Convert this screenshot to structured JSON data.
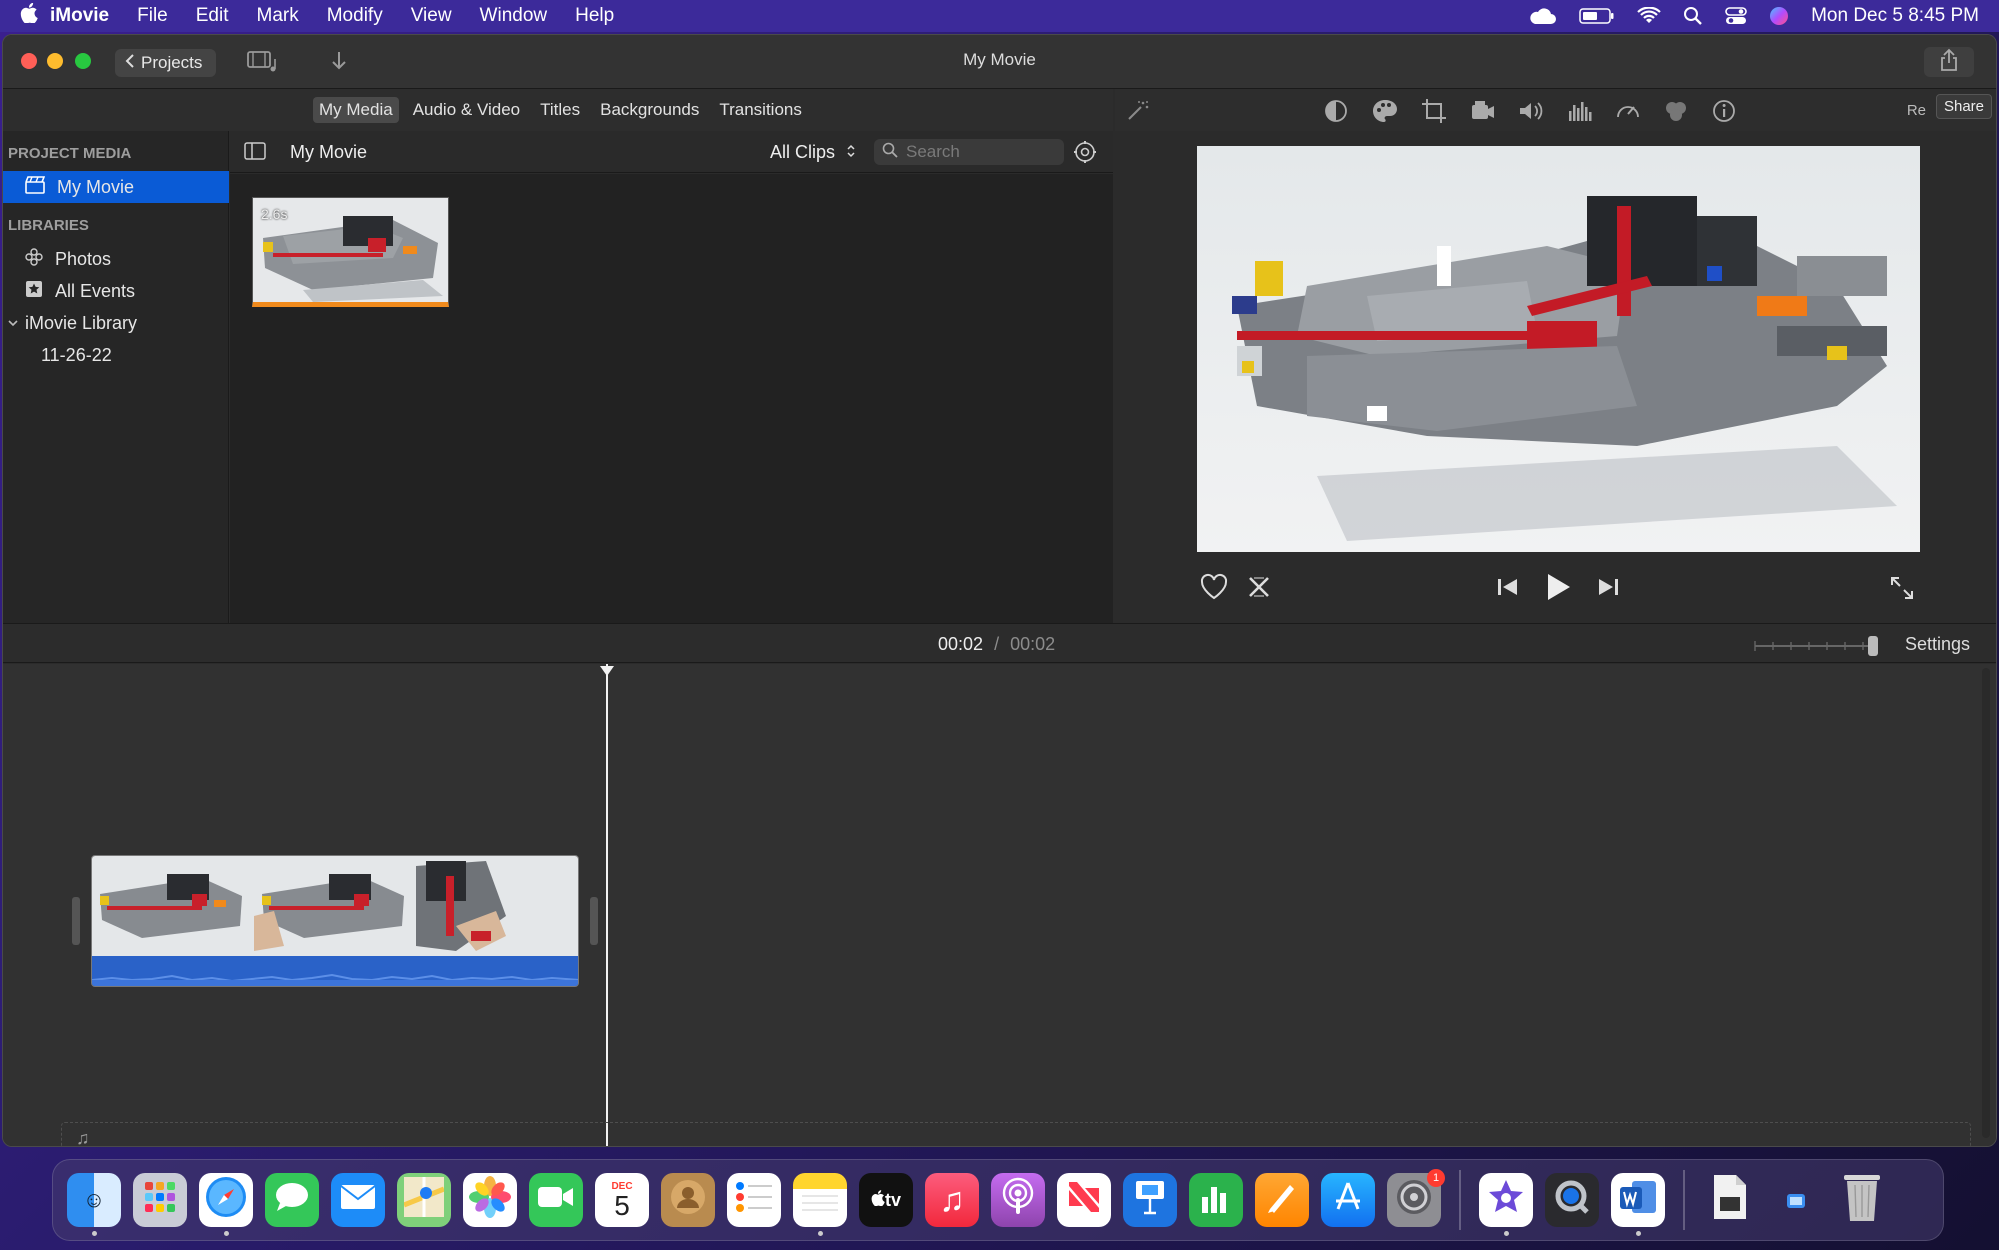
{
  "menubar": {
    "app_name": "iMovie",
    "items": [
      "File",
      "Edit",
      "Mark",
      "Modify",
      "View",
      "Window",
      "Help"
    ],
    "clock": "Mon Dec 5  8:45 PM"
  },
  "window": {
    "title": "My Movie",
    "projects_label": "Projects"
  },
  "tabs": [
    "My Media",
    "Audio & Video",
    "Titles",
    "Backgrounds",
    "Transitions"
  ],
  "sidebar": {
    "project_media_heading": "PROJECT MEDIA",
    "project_item": "My Movie",
    "libraries_heading": "LIBRARIES",
    "photos": "Photos",
    "all_events": "All Events",
    "library": "iMovie Library",
    "event": "11-26-22"
  },
  "browser": {
    "title": "My Movie",
    "filter": "All Clips",
    "search_placeholder": "Search",
    "clip_duration": "2.6s"
  },
  "viewer": {
    "share_tooltip": "Share",
    "re_text": "Re"
  },
  "timeline": {
    "current_time": "00:02",
    "separator": "/",
    "total_time": "00:02",
    "settings_label": "Settings"
  },
  "dock": {
    "apps": [
      "finder",
      "launchpad",
      "safari",
      "messages",
      "mail",
      "maps",
      "photos",
      "facetime",
      "calendar",
      "contacts",
      "reminders",
      "notes",
      "tv",
      "music",
      "podcasts",
      "news",
      "keynote",
      "numbers",
      "pages",
      "app-store",
      "system-preferences",
      "imovie",
      "quicktime",
      "word",
      "document",
      "preview",
      "trash"
    ],
    "calendar_month": "DEC",
    "calendar_day": "5",
    "tv_label": "tv",
    "settings_badge": "1"
  }
}
